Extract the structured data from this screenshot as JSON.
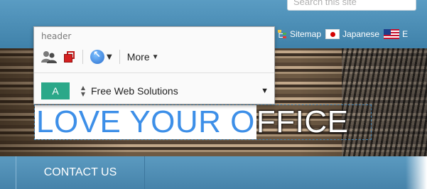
{
  "search": {
    "placeholder": "Search this site"
  },
  "top_links": [
    {
      "label": "Sitemap",
      "icon": "sitemap-icon"
    },
    {
      "label": "Japanese",
      "icon": "japan-flag-icon"
    },
    {
      "label": "E",
      "icon": "us-flag-icon"
    }
  ],
  "banner": {
    "headline_selected": "LOVE YOUR O",
    "headline_rest": "FFICE"
  },
  "nav": {
    "items": [
      {
        "label": "CONTACT US"
      }
    ]
  },
  "toolbar": {
    "title": "header",
    "more_label": "More",
    "badge_label": "A",
    "style_value": "Free Web Solutions"
  },
  "colors": {
    "header_blue": "#4a8db5",
    "selection_text": "#3d8fe8",
    "badge_green": "#2ba889"
  }
}
